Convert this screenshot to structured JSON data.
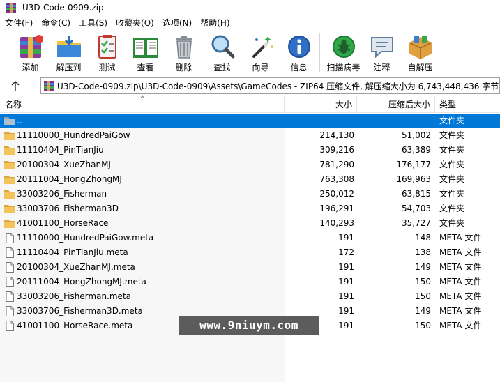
{
  "window": {
    "title": "U3D-Code-0909.zip"
  },
  "menu": [
    "文件(F)",
    "命令(C)",
    "工具(S)",
    "收藏夹(O)",
    "选项(N)",
    "帮助(H)"
  ],
  "toolbar": [
    {
      "label": "添加",
      "icon": "add-icon"
    },
    {
      "label": "解压到",
      "icon": "extract-to-icon"
    },
    {
      "label": "测试",
      "icon": "test-icon"
    },
    {
      "label": "查看",
      "icon": "view-icon"
    },
    {
      "label": "删除",
      "icon": "delete-icon"
    },
    {
      "label": "查找",
      "icon": "find-icon"
    },
    {
      "label": "向导",
      "icon": "wizard-icon"
    },
    {
      "label": "信息",
      "icon": "info-icon"
    },
    {
      "label": "扫描病毒",
      "icon": "virus-scan-icon"
    },
    {
      "label": "注释",
      "icon": "comment-icon"
    },
    {
      "label": "自解压",
      "icon": "sfx-icon"
    }
  ],
  "address": {
    "path": "U3D-Code-0909.zip\\U3D-Code-0909\\Assets\\GameCodes - ZIP64 压缩文件, 解压缩大小为 6,743,448,436 字节"
  },
  "columns": {
    "name": "名称",
    "size": "大小",
    "packed": "压缩后大小",
    "type": "类型"
  },
  "files": [
    {
      "name": "..",
      "size": "",
      "packed": "",
      "type": "文件夹",
      "kind": "parent",
      "selected": true
    },
    {
      "name": "11110000_HundredPaiGow",
      "size": "214,130",
      "packed": "51,002",
      "type": "文件夹",
      "kind": "folder"
    },
    {
      "name": "11110404_PinTianJiu",
      "size": "309,216",
      "packed": "63,389",
      "type": "文件夹",
      "kind": "folder"
    },
    {
      "name": "20100304_XueZhanMJ",
      "size": "781,290",
      "packed": "176,177",
      "type": "文件夹",
      "kind": "folder"
    },
    {
      "name": "20111004_HongZhongMJ",
      "size": "763,308",
      "packed": "169,963",
      "type": "文件夹",
      "kind": "folder"
    },
    {
      "name": "33003206_Fisherman",
      "size": "250,012",
      "packed": "63,815",
      "type": "文件夹",
      "kind": "folder"
    },
    {
      "name": "33003706_Fisherman3D",
      "size": "196,291",
      "packed": "54,703",
      "type": "文件夹",
      "kind": "folder"
    },
    {
      "name": "41001100_HorseRace",
      "size": "140,293",
      "packed": "35,727",
      "type": "文件夹",
      "kind": "folder"
    },
    {
      "name": "11110000_HundredPaiGow.meta",
      "size": "191",
      "packed": "148",
      "type": "META 文件",
      "kind": "file"
    },
    {
      "name": "11110404_PinTianJiu.meta",
      "size": "172",
      "packed": "138",
      "type": "META 文件",
      "kind": "file"
    },
    {
      "name": "20100304_XueZhanMJ.meta",
      "size": "191",
      "packed": "149",
      "type": "META 文件",
      "kind": "file"
    },
    {
      "name": "20111004_HongZhongMJ.meta",
      "size": "191",
      "packed": "150",
      "type": "META 文件",
      "kind": "file"
    },
    {
      "name": "33003206_Fisherman.meta",
      "size": "191",
      "packed": "150",
      "type": "META 文件",
      "kind": "file"
    },
    {
      "name": "33003706_Fisherman3D.meta",
      "size": "191",
      "packed": "149",
      "type": "META 文件",
      "kind": "file"
    },
    {
      "name": "41001100_HorseRace.meta",
      "size": "191",
      "packed": "150",
      "type": "META 文件",
      "kind": "file"
    }
  ],
  "watermark": "www.9niuym.com",
  "colors": {
    "selection": "#0078d7",
    "folder": "#f2c55c",
    "folderDark": "#dca43a"
  }
}
